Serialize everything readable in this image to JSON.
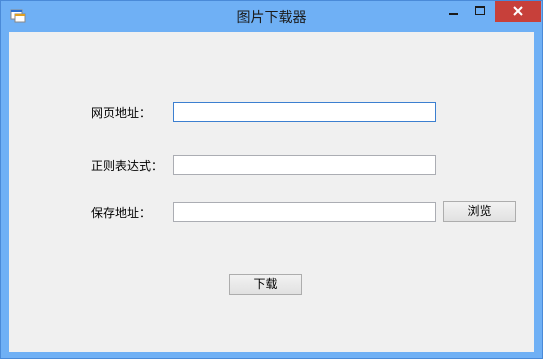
{
  "window": {
    "title": "图片下载器",
    "icon": "app-window-icon",
    "controls": [
      "minimize-icon",
      "maximize-icon",
      "close-icon"
    ]
  },
  "form": {
    "url_label": "网页地址：",
    "url_value": "",
    "regex_label": "正则表达式：",
    "regex_value": "",
    "save_label": "保存地址：",
    "save_value": "",
    "browse_button": "浏览",
    "download_button": "下载"
  },
  "colors": {
    "titlebar": "#6fb0f5",
    "close_button": "#c7403a",
    "client_bg": "#f0f0f0",
    "focus_border": "#3c7fd0"
  }
}
